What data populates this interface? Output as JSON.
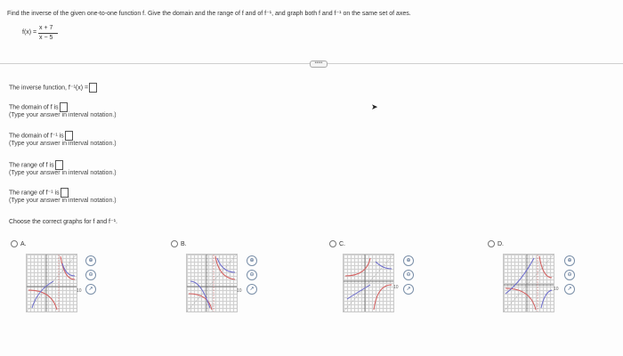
{
  "question": {
    "prompt": "Find the inverse of the given one-to-one function f. Give the domain and the range of f and of f⁻¹, and graph both f and f⁻¹ on the same set of axes.",
    "fx_label": "f(x) =",
    "numerator": "x + 7",
    "denominator": "x − 5"
  },
  "more_label": "•••••",
  "items": {
    "inverse": "The inverse function, f⁻¹(x) =",
    "domain_f": "The domain of f is",
    "domain_finv": "The domain of f⁻¹ is",
    "range_f": "The range of f is",
    "range_finv": "The range of f⁻¹ is",
    "hint": "(Type your answer in interval notation.)",
    "choose": "Choose the correct graphs for f and f⁻¹."
  },
  "options": [
    {
      "label": "A."
    },
    {
      "label": "B."
    },
    {
      "label": "C."
    },
    {
      "label": "D."
    }
  ],
  "graph_tick": "10"
}
